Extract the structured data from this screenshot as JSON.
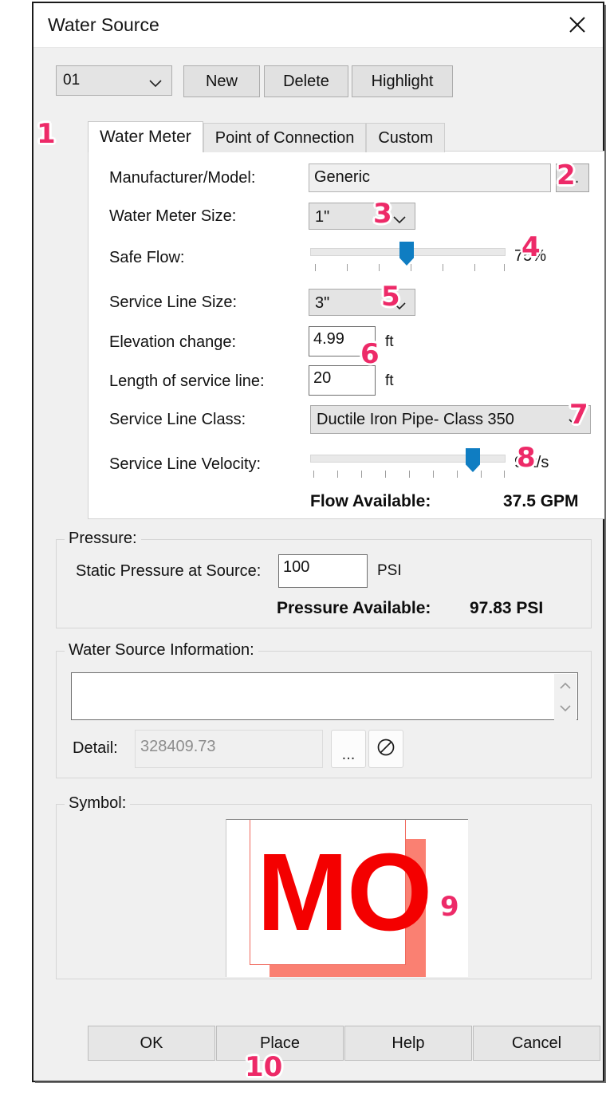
{
  "window": {
    "title": "Water Source",
    "close_icon": "close-icon"
  },
  "toolbar": {
    "source_select_value": "01",
    "new_label": "New",
    "delete_label": "Delete",
    "highlight_label": "Highlight"
  },
  "tabs": [
    {
      "label": "Water Meter",
      "active": true
    },
    {
      "label": "Point of Connection",
      "active": false
    },
    {
      "label": "Custom",
      "active": false
    }
  ],
  "water_meter": {
    "manufacturer_label": "Manufacturer/Model:",
    "manufacturer_value": "Generic",
    "manufacturer_browse_label": "...",
    "meter_size_label": "Water Meter Size:",
    "meter_size_value": "1\"",
    "safe_flow_label": "Safe Flow:",
    "safe_flow_value": "75%",
    "safe_flow_percent": 75,
    "service_line_size_label": "Service Line Size:",
    "service_line_size_value": "3\"",
    "elevation_label": "Elevation change:",
    "elevation_value": "4.99",
    "elevation_unit": "ft",
    "length_label": "Length of service line:",
    "length_value": "20",
    "length_unit": "ft",
    "service_line_class_label": "Service Line Class:",
    "service_line_class_value": "Ductile Iron Pipe- Class 350",
    "velocity_label": "Service Line Velocity:",
    "velocity_value": "9 ft/s",
    "velocity_percent": 86,
    "flow_available_label": "Flow Available:",
    "flow_available_value": "37.5 GPM"
  },
  "pressure": {
    "group_title": "Pressure:",
    "static_label": "Static Pressure at Source:",
    "static_value": "100",
    "static_unit": "PSI",
    "available_label": "Pressure Available:",
    "available_value": "97.83 PSI"
  },
  "water_source_info": {
    "group_title": "Water Source Information:",
    "notes_value": "",
    "notes_placeholder": "",
    "detail_label": "Detail:",
    "detail_value": "328409.73",
    "detail_browse_label": "...",
    "detail_clear_icon": "no-entry-icon"
  },
  "symbol": {
    "group_title": "Symbol:",
    "preview_text": "MO",
    "preview_color": "#f40000",
    "shadow_color": "#fa8072",
    "outline_color": "#f0685c"
  },
  "footer": {
    "ok_label": "OK",
    "place_label": "Place",
    "help_label": "Help",
    "cancel_label": "Cancel"
  },
  "annotations": [
    {
      "number": "1"
    },
    {
      "number": "2"
    },
    {
      "number": "3"
    },
    {
      "number": "4"
    },
    {
      "number": "5"
    },
    {
      "number": "6"
    },
    {
      "number": "7"
    },
    {
      "number": "8"
    },
    {
      "number": "9"
    },
    {
      "number": "10"
    }
  ],
  "colors": {
    "badge": "#ed2a68",
    "slider_thumb": "#0f7dc2",
    "dialog_bg": "#f0f0f0"
  }
}
